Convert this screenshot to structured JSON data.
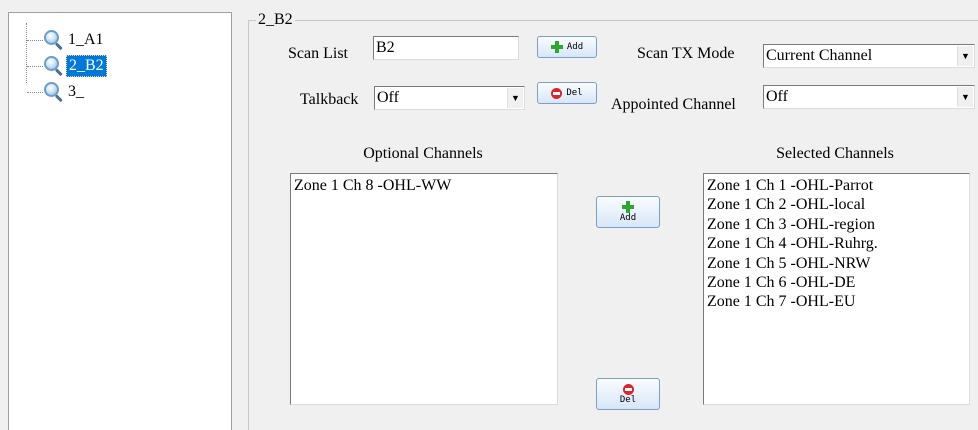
{
  "tree": {
    "nodes": [
      {
        "label": "1_A1",
        "selected": false,
        "icon": "magnifier-icon"
      },
      {
        "label": "2_B2",
        "selected": true,
        "icon": "magnifier-icon"
      },
      {
        "label": "3_",
        "selected": false,
        "icon": "magnifier-icon"
      }
    ]
  },
  "group": {
    "title": "2_B2"
  },
  "form": {
    "scan_list_label": "Scan List",
    "scan_list_value": "B2",
    "add_label": "Add",
    "scan_tx_mode_label": "Scan TX Mode",
    "scan_tx_mode_value": "Current Channel",
    "talkback_label": "Talkback",
    "talkback_value": "Off",
    "del_label": "Del",
    "appointed_channel_label": "Appointed Channel",
    "appointed_channel_value": "Off"
  },
  "optional": {
    "header": "Optional Channels",
    "items": [
      "Zone 1 Ch 8 -OHL-WW"
    ]
  },
  "selected": {
    "header": "Selected Channels",
    "items": [
      "Zone 1 Ch 1 -OHL-Parrot",
      "Zone 1 Ch 2 -OHL-local",
      "Zone 1 Ch 3 -OHL-region",
      "Zone 1 Ch 4 -OHL-Ruhrg.",
      "Zone 1 Ch 5 -OHL-NRW",
      "Zone 1 Ch 6 -OHL-DE",
      "Zone 1 Ch 7 -OHL-EU"
    ]
  },
  "transfer": {
    "add_label": "Add",
    "del_label": "Del"
  },
  "colors": {
    "selection": "#0078d7",
    "add_icon": "#2fa62f",
    "del_icon": "#d8262c"
  }
}
